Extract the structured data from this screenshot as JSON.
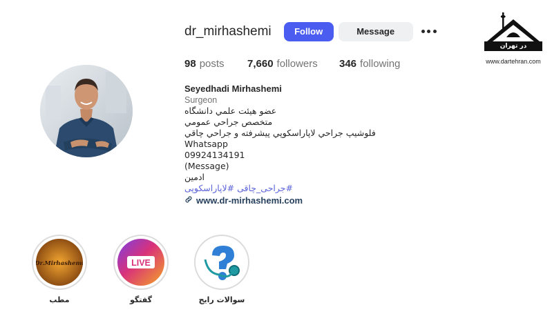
{
  "profile": {
    "username": "dr_mirhashemi",
    "follow_label": "Follow",
    "message_label": "Message",
    "more_icon": "more-horizontal-icon",
    "stats": {
      "posts_count": "98",
      "posts_label": "posts",
      "followers_count": "7,660",
      "followers_label": "followers",
      "following_count": "346",
      "following_label": "following"
    },
    "bio": {
      "name": "Seyedhadi Mirhashemi",
      "category": "Surgeon",
      "lines": [
        "عضو هيئت علمي دانشگاه",
        "متخصص جراحي عمومي",
        "فلوشيپ جراحي لاپاراسكوپي پيشرفته و جراحي چاقي",
        "Whatsapp",
        "09924134191",
        "(Message)",
        "ادمين"
      ],
      "hashtags": "#جراحی_چاقی #لاپاراسکوپی",
      "link_icon": "link-icon",
      "website": "www.dr-mirhashemi.com"
    }
  },
  "highlights": [
    {
      "label": "مطب",
      "image_text": "Dr.Mirhashemi"
    },
    {
      "label": "گفتگو",
      "image_text": "LIVE"
    },
    {
      "label": "سوالات رايج",
      "image_text": ""
    }
  ],
  "watermark": {
    "logo_text": "در تهران",
    "url": "www.dartehran.com"
  },
  "colors": {
    "follow_button": "#4a5df0",
    "message_button": "#eef0f2",
    "hashtag": "#5b63d9",
    "website": "#27415f"
  }
}
